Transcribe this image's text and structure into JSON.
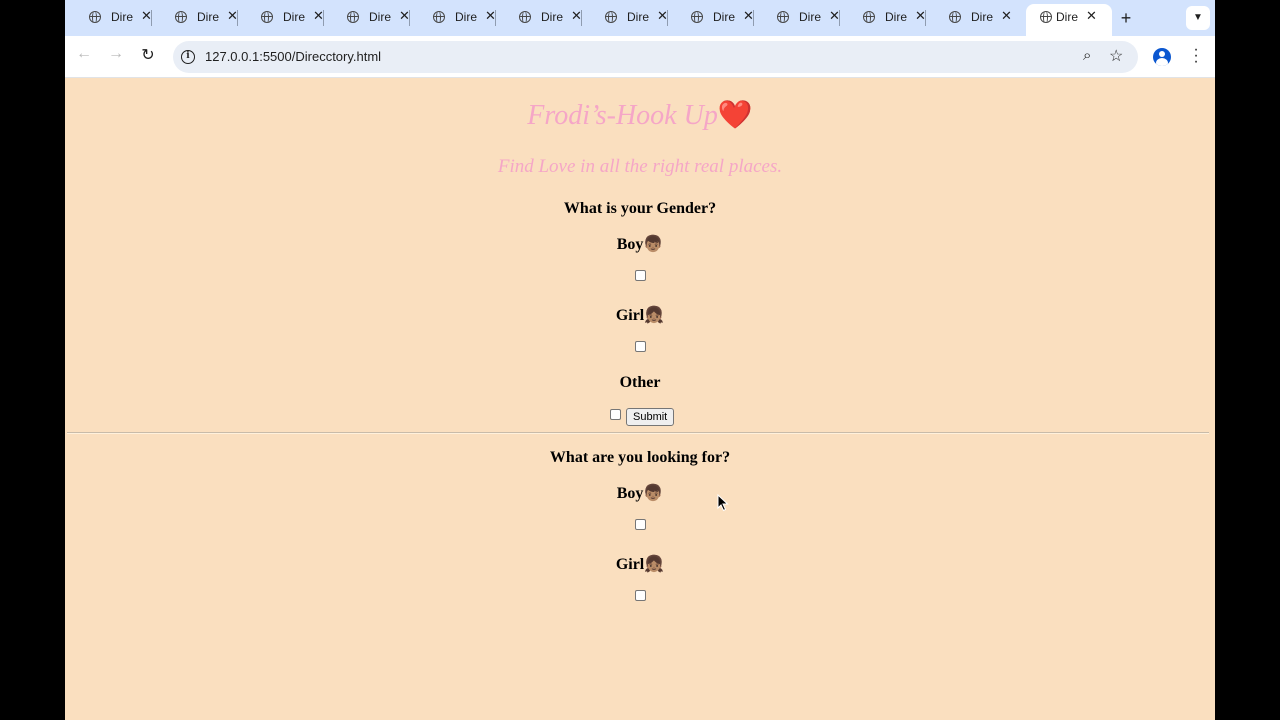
{
  "browser": {
    "tabs": [
      {
        "label": "Dire"
      },
      {
        "label": "Dire"
      },
      {
        "label": "Dire"
      },
      {
        "label": "Dire"
      },
      {
        "label": "Dire"
      },
      {
        "label": "Dire"
      },
      {
        "label": "Dire"
      },
      {
        "label": "Dire"
      },
      {
        "label": "Dire"
      },
      {
        "label": "Dire"
      },
      {
        "label": "Dire"
      },
      {
        "label": "Dire"
      }
    ],
    "active_tab_index": 11,
    "url": "127.0.0.1:5500/Direcctory.html",
    "new_tab": "+",
    "icons": [
      "globe-icon",
      "close-icon",
      "plus-icon",
      "chevron-down-icon",
      "back-arrow-icon",
      "forward-arrow-icon",
      "reload-icon",
      "info-icon",
      "zoom-icon",
      "star-icon",
      "profile-icon",
      "kebab-menu-icon"
    ]
  },
  "page": {
    "title": "Frodi’s-Hook Up",
    "title_emoji": "❤️",
    "tagline": "Find Love in all the right real places.",
    "gender_question": "What is your Gender?",
    "gender_options": [
      {
        "label": "Boy",
        "emoji": "👦🏽"
      },
      {
        "label": "Girl",
        "emoji": "👧🏽"
      },
      {
        "label": "Other",
        "emoji": ""
      }
    ],
    "submit_label": "Submit",
    "looking_question": "What are you looking for?",
    "looking_options": [
      {
        "label": "Boy",
        "emoji": "👦🏽"
      },
      {
        "label": "Girl",
        "emoji": "👧🏽"
      }
    ]
  },
  "colors": {
    "page_background": "#fadfbf",
    "title_color": "#f5a6c7",
    "tab_strip": "#d3e3fd"
  }
}
